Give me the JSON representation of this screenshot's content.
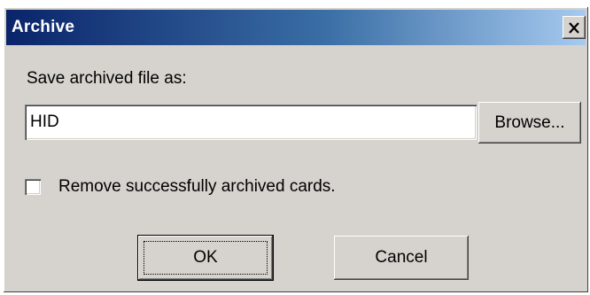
{
  "window": {
    "title": "Archive",
    "close_icon": "close-icon"
  },
  "form": {
    "save_label": "Save archived file as:",
    "filename_value": "HID",
    "browse_label": "Browse...",
    "remove_label": "Remove successfully archived cards.",
    "remove_checked": false
  },
  "buttons": {
    "ok_label": "OK",
    "cancel_label": "Cancel"
  },
  "colors": {
    "titlebar_start": "#0a246a",
    "titlebar_end": "#a6caf0",
    "dialog_background": "#d6d3ce"
  }
}
